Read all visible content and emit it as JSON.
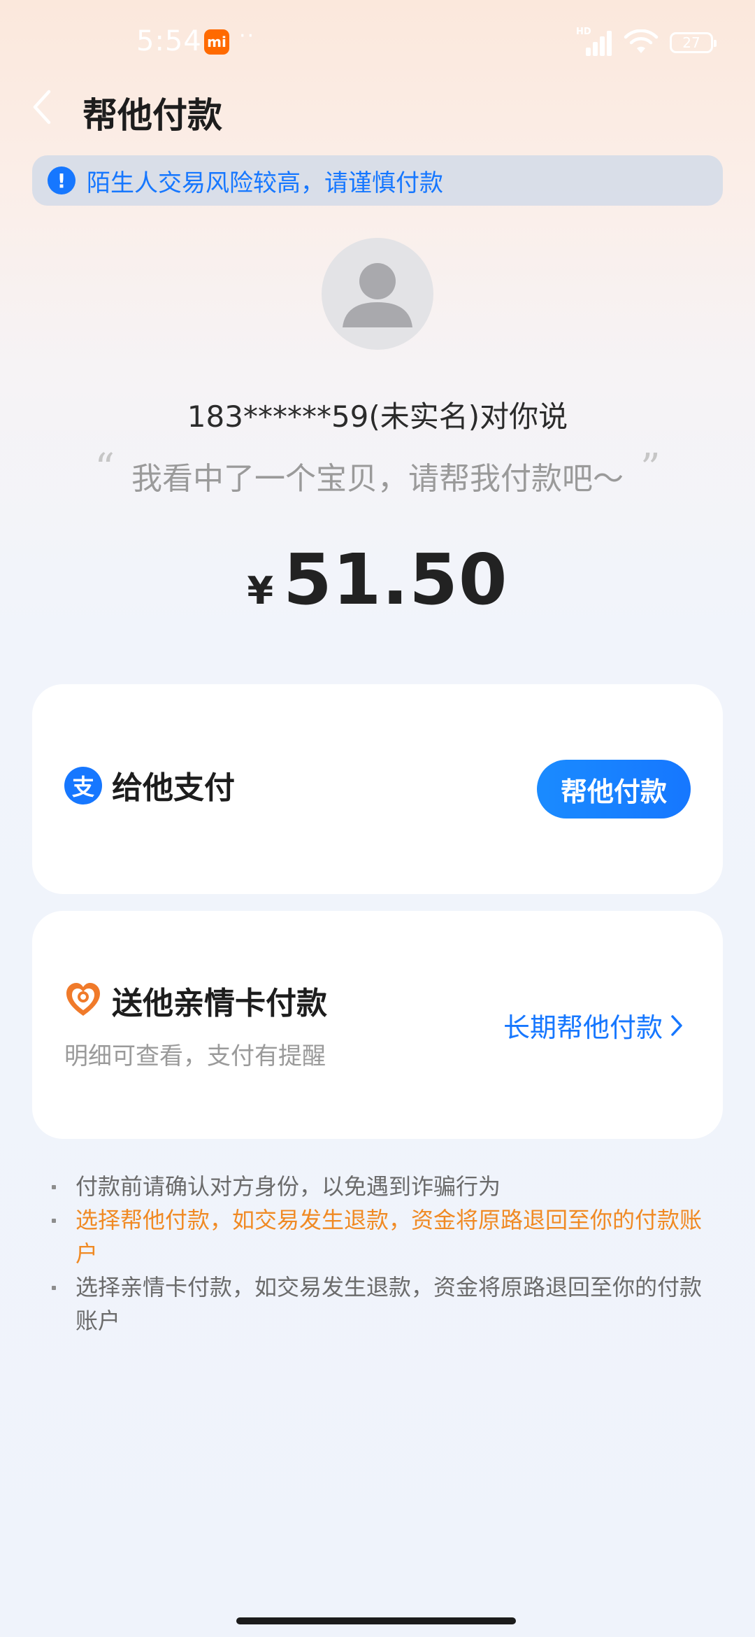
{
  "status_bar": {
    "time": "5:54",
    "mi_label": "mi",
    "dots": "··",
    "network_label": "HD",
    "battery": "27"
  },
  "header": {
    "title": "帮他付款"
  },
  "warning": {
    "icon_symbol": "!",
    "text": "陌生人交易风险较高，请谨慎付款"
  },
  "requester": {
    "line": "183******59(未实名)对你说"
  },
  "message": {
    "quote_open": "“",
    "text": "我看中了一个宝贝，请帮我付款吧～",
    "quote_close": "”"
  },
  "amount": {
    "currency": "¥",
    "value": "51.50"
  },
  "pay_option": {
    "icon_char": "支",
    "title": "给他支付",
    "button_label": "帮他付款"
  },
  "family_option": {
    "title": "送他亲情卡付款",
    "subtitle": "明细可查看，支付有提醒",
    "link_label": "长期帮他付款"
  },
  "notes": [
    "付款前请确认对方身份，以免遇到诈骗行为",
    "选择帮他付款，如交易发生退款，资金将原路退回至你的付款账户",
    "选择亲情卡付款，如交易发生退款，资金将原路退回至你的付款账户"
  ],
  "colors": {
    "accent": "#1677ff",
    "highlight": "#f08a24",
    "family_icon": "#f07a2a"
  },
  "icons": {
    "back": "back-arrow-icon",
    "warning": "exclamation-icon",
    "avatar": "person-silhouette-icon",
    "pay": "alipay-icon",
    "family": "heart-card-icon",
    "chevron": "chevron-right-icon"
  }
}
